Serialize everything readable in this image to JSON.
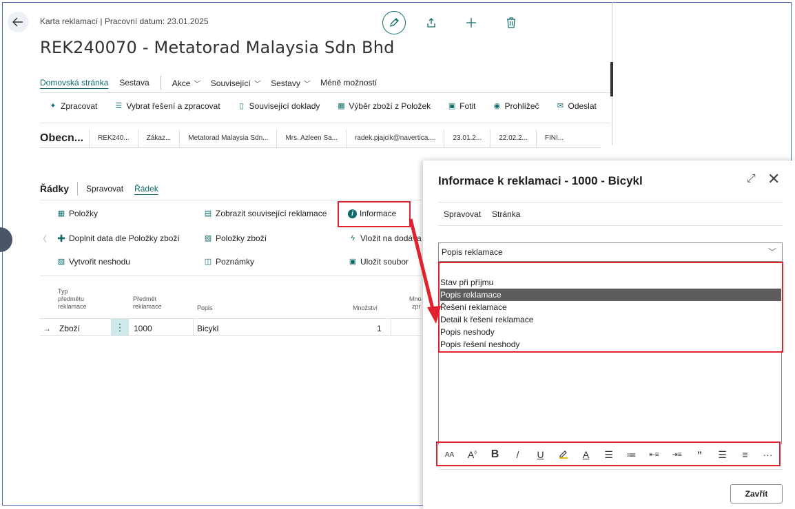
{
  "header": {
    "breadcrumb": "Karta reklamací | Pracovní datum: 23.01.2025",
    "title": "REK240070 - Metatorad Malaysia Sdn Bhd"
  },
  "menu": {
    "home": "Domovská stránka",
    "report": "Sestava",
    "actions": "Akce",
    "related": "Související",
    "reports": "Sestavy",
    "less": "Méně možností"
  },
  "actions": [
    {
      "label": "Zpracovat",
      "icon": "process-icon"
    },
    {
      "label": "Vybrat řešení a zpracovat",
      "icon": "select-list-icon"
    },
    {
      "label": "Související doklady",
      "icon": "document-icon"
    },
    {
      "label": "Výběr zboží z Položek",
      "icon": "grid-icon"
    },
    {
      "label": "Fotit",
      "icon": "camera-icon"
    },
    {
      "label": "Prohlížeč",
      "icon": "eye-icon"
    },
    {
      "label": "Odeslat",
      "icon": "mail-icon"
    }
  ],
  "fasttab": {
    "title": "Obecn...",
    "cells": [
      "REK240...",
      "Zákaz...",
      "Metatorad Malaysia Sdn...",
      "Mrs. Azleen Sa...",
      "radek.pjajcik@navertica....",
      "23.01.2...",
      "22.02.2...",
      "FINI..."
    ]
  },
  "lines": {
    "title": "Řádky",
    "manage": "Spravovat",
    "line": "Řádek",
    "actions": {
      "polozky": "Položky",
      "zobrazit": "Zobrazit související reklamace",
      "informace": "Informace",
      "doplnit": "Doplnit data dle Položky zboží",
      "polozky_zbozi": "Položky zboží",
      "vlozit": "Vložit na dodáva",
      "vytvorit": "Vytvořit neshodu",
      "poznamky": "Poznámky",
      "ulozit": "Uložit soubor"
    },
    "columns": {
      "typ": [
        "Typ",
        "předmětu",
        "reklamace"
      ],
      "predmet": [
        "Předmět",
        "reklamace"
      ],
      "popis": "Popis",
      "mnozstvi": "Množství",
      "mno": [
        "Mno",
        "zpr"
      ]
    },
    "row": {
      "arrow": "→",
      "typ": "Zboží",
      "predmet": "1000",
      "popis": "Bicykl",
      "mnozstvi": "1"
    }
  },
  "dialog": {
    "title": "Informace k reklamaci - 1000 - Bicykl",
    "menu": {
      "manage": "Spravovat",
      "page": "Stránka"
    },
    "selected": "Popis reklamace",
    "options": [
      "Stav při příjmu",
      "Popis reklamace",
      "Řešení reklamace",
      "Detail k řešení reklamace",
      "Popis neshody",
      "Popis řešení neshody"
    ],
    "toolbar": {
      "font_size": "AA",
      "grow": "A",
      "bold": "B",
      "italic": "/",
      "underline": "U",
      "color": "A",
      "quote": "”",
      "more": "···"
    },
    "close_button": "Zavřít"
  },
  "colors": {
    "accent": "#0f6b6b",
    "highlight": "#e0222e",
    "selected_bg": "#5c5c5c"
  }
}
